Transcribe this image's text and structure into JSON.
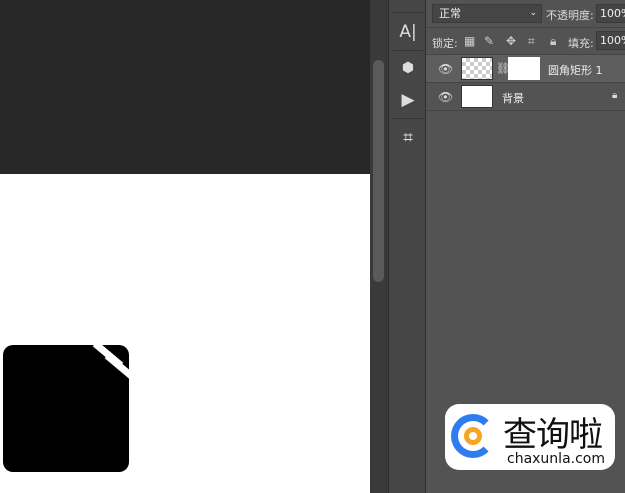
{
  "layers_panel": {
    "blend_mode": "正常",
    "opacity_label": "不透明度:",
    "opacity_value": "100%",
    "lock_label": "锁定:",
    "fill_label": "填充:",
    "fill_value": "100%",
    "layers": [
      {
        "name": "圆角矩形 1",
        "visible": true,
        "selected": true
      },
      {
        "name": "背景",
        "visible": true,
        "locked": true
      }
    ]
  },
  "watermark": {
    "cn": "查询啦",
    "url": "chaxunla.com"
  },
  "tools": {
    "type_tool": "A|"
  }
}
